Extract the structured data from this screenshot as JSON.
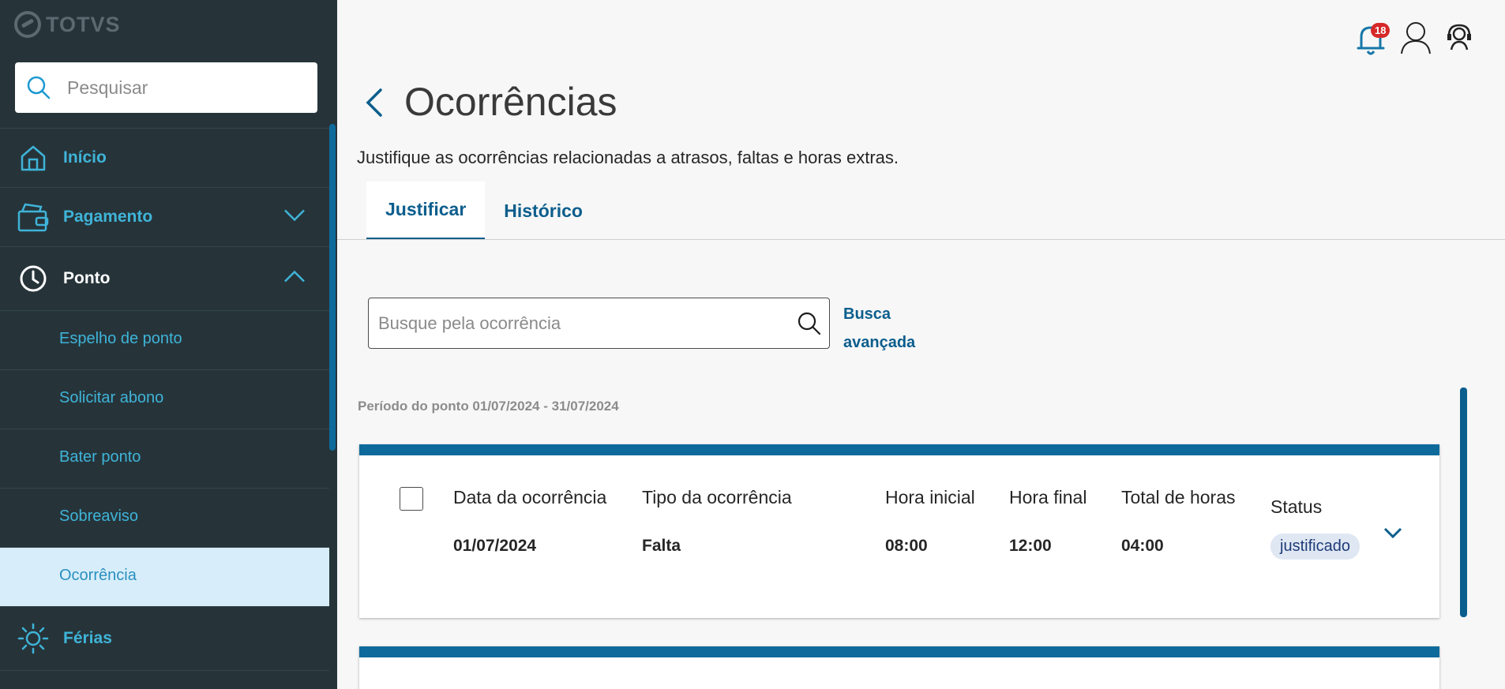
{
  "sidebar": {
    "logo": "TOTVS",
    "search_placeholder": "Pesquisar",
    "items": [
      {
        "label": "Início"
      },
      {
        "label": "Pagamento"
      },
      {
        "label": "Ponto"
      }
    ],
    "sub_items": [
      {
        "label": "Espelho de ponto"
      },
      {
        "label": "Solicitar abono"
      },
      {
        "label": "Bater ponto"
      },
      {
        "label": "Sobreaviso"
      },
      {
        "label": "Ocorrência"
      }
    ],
    "ferias": {
      "label": "Férias"
    }
  },
  "header": {
    "notification_count": "18"
  },
  "page": {
    "title": "Ocorrências",
    "subtitle": "Justifique as ocorrências relacionadas a atrasos, faltas e horas extras.",
    "tabs": [
      {
        "label": "Justificar"
      },
      {
        "label": "Histórico"
      }
    ],
    "search_placeholder": "Busque pela ocorrência",
    "advanced_search": [
      "Busca",
      "avançada"
    ],
    "period": "Período do ponto 01/07/2024 - 31/07/2024"
  },
  "columns": [
    "Data da ocorrência",
    "Tipo da ocorrência",
    "Hora inicial",
    "Hora final",
    "Total de horas",
    "Status"
  ],
  "rows": [
    {
      "date": "01/07/2024",
      "type": "Falta",
      "start": "08:00",
      "end": "12:00",
      "total": "04:00",
      "status": "justificado"
    }
  ],
  "colors": {
    "sidebar_bg": "#26343a",
    "accent": "#0e6a9b",
    "nav_text": "#3fb4d8",
    "active_bg": "#d7eefa",
    "badge": "#d62828"
  }
}
